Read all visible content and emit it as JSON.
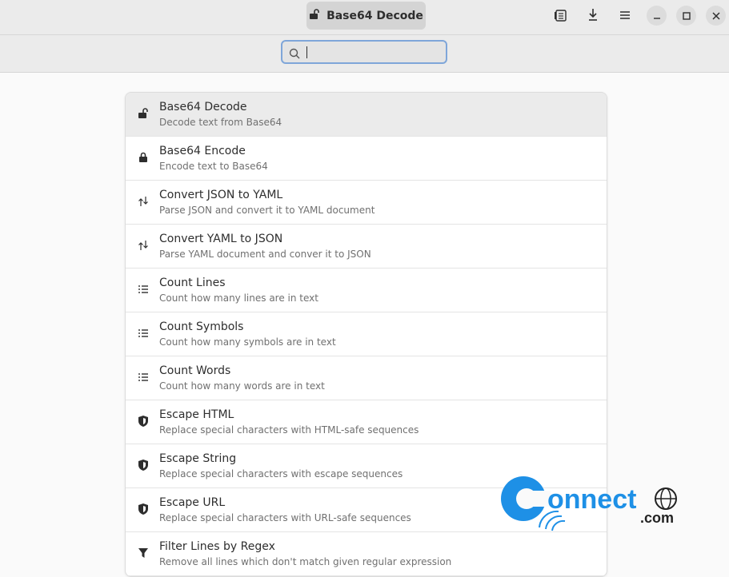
{
  "titlebar": {
    "title": "Base64 Decode",
    "icons": [
      "library-icon",
      "download-icon",
      "menu-icon"
    ],
    "window_controls": [
      "minimize-icon",
      "maximize-icon",
      "close-icon"
    ]
  },
  "search": {
    "value": "",
    "placeholder": ""
  },
  "tools": [
    {
      "title": "Base64 Decode",
      "subtitle": "Decode text from Base64",
      "icon": "unlock-icon",
      "selected": true
    },
    {
      "title": "Base64 Encode",
      "subtitle": "Encode text to Base64",
      "icon": "lock-icon"
    },
    {
      "title": "Convert JSON to YAML",
      "subtitle": "Parse JSON and convert it to YAML document",
      "icon": "convert-icon"
    },
    {
      "title": "Convert YAML to JSON",
      "subtitle": "Parse YAML document and conver it to JSON",
      "icon": "convert-icon"
    },
    {
      "title": "Count Lines",
      "subtitle": "Count how many lines are in text",
      "icon": "list-icon"
    },
    {
      "title": "Count Symbols",
      "subtitle": "Count how many symbols are in text",
      "icon": "list-icon"
    },
    {
      "title": "Count Words",
      "subtitle": "Count how many words are in text",
      "icon": "list-icon"
    },
    {
      "title": "Escape HTML",
      "subtitle": "Replace special characters with HTML-safe sequences",
      "icon": "shield-icon"
    },
    {
      "title": "Escape String",
      "subtitle": "Replace special characters with escape sequences",
      "icon": "shield-icon"
    },
    {
      "title": "Escape URL",
      "subtitle": "Replace special characters with URL-safe sequences",
      "icon": "shield-icon"
    },
    {
      "title": "Filter Lines by Regex",
      "subtitle": "Remove all lines which don't match given regular expression",
      "icon": "filter-icon"
    }
  ],
  "watermark": {
    "brand": "onnect",
    "suffix": ".com"
  },
  "colors": {
    "accent": "#3584e4",
    "watermark_blue": "#1e90e6"
  }
}
